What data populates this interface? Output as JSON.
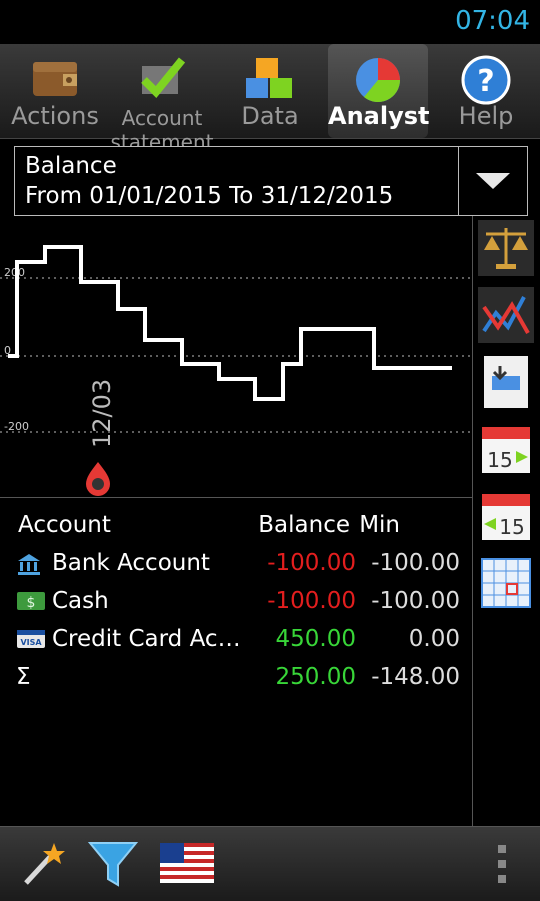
{
  "status": {
    "time": "07:04"
  },
  "tabs": [
    {
      "label": "Actions",
      "icon": "wallet-icon"
    },
    {
      "label": "Account statement",
      "icon": "checkmark-icon"
    },
    {
      "label": "Data",
      "icon": "boxes-icon"
    },
    {
      "label": "Analyst",
      "icon": "pie-chart-icon",
      "active": true
    },
    {
      "label": "Help",
      "icon": "help-icon"
    }
  ],
  "selector": {
    "line1": "Balance",
    "line2": "From 01/01/2015 To 31/12/2015"
  },
  "chart_data": {
    "type": "line",
    "ytick_labels": [
      "200",
      "0",
      "-200"
    ],
    "marker_label": "12/03",
    "grid": "dotted horizontal",
    "series": [
      {
        "x": [
          0,
          0.02,
          0.02,
          0.08,
          0.08,
          0.16,
          0.16,
          0.24,
          0.24,
          0.3,
          0.3,
          0.38,
          0.38,
          0.46,
          0.46,
          0.54,
          0.54,
          0.6,
          0.6,
          0.64,
          0.64,
          0.8,
          0.8,
          0.97
        ],
        "y": [
          0,
          0,
          240,
          240,
          280,
          280,
          190,
          190,
          120,
          120,
          40,
          40,
          -20,
          -20,
          -60,
          -60,
          -110,
          -110,
          -20,
          -20,
          70,
          70,
          -30,
          -30
        ]
      }
    ]
  },
  "side_buttons": [
    "scales-icon",
    "line-chart-icon",
    "compare-icon",
    "calendar-next-icon",
    "calendar-prev-icon",
    "calendar-grid-icon"
  ],
  "table": {
    "headers": {
      "account": "Account",
      "balance": "Balance",
      "min": "Min"
    },
    "rows": [
      {
        "icon": "bank-icon",
        "name": "Bank Account",
        "balance": "-100.00",
        "min": "-100.00",
        "sign": "neg"
      },
      {
        "icon": "cash-icon",
        "name": "Cash",
        "balance": "-100.00",
        "min": "-100.00",
        "sign": "neg"
      },
      {
        "icon": "credit-card-icon",
        "name": "Credit Card Ac…",
        "balance": "450.00",
        "min": "0.00",
        "sign": "pos"
      },
      {
        "icon": "sigma-icon",
        "name": "Σ",
        "balance": "250.00",
        "min": "-148.00",
        "sign": "pos"
      }
    ]
  },
  "colors": {
    "accent": "#33b5e5",
    "negative": "#e31e1e",
    "positive": "#38d638"
  }
}
